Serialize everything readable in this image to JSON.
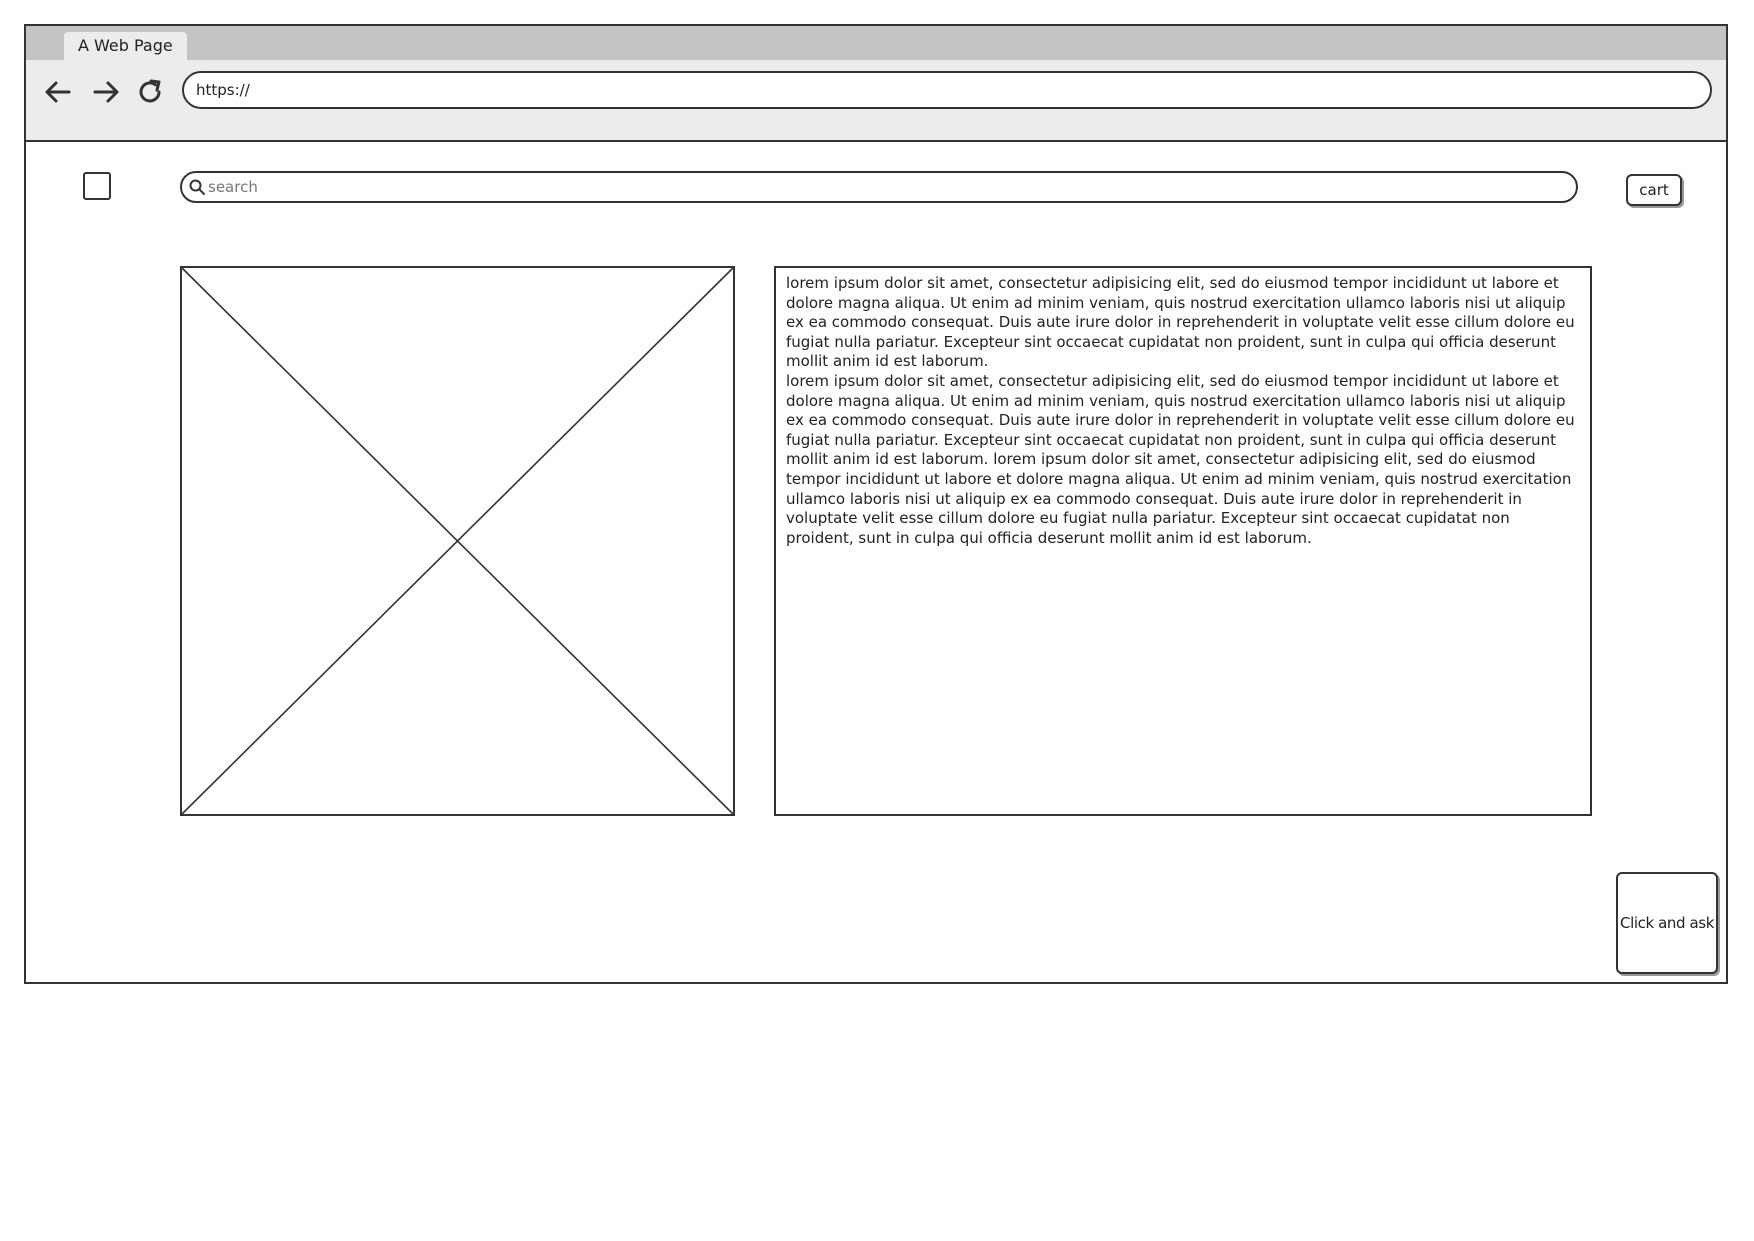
{
  "browser": {
    "tab_title": "A Web Page",
    "url": "https://"
  },
  "header": {
    "search_placeholder": "search",
    "cart_label": "cart"
  },
  "content": {
    "paragraph_1": "lorem ipsum dolor sit amet, consectetur adipisicing elit, sed do eiusmod tempor incididunt ut labore et dolore magna aliqua. Ut enim ad minim veniam, quis nostrud exercitation ullamco laboris nisi ut aliquip ex ea commodo consequat. Duis aute irure dolor in reprehenderit in voluptate velit esse cillum dolore eu fugiat nulla pariatur. Excepteur sint occaecat cupidatat non proident, sunt in culpa qui officia deserunt mollit anim id est laborum.",
    "paragraph_2": "lorem ipsum dolor sit amet, consectetur adipisicing elit, sed do eiusmod tempor incididunt ut labore et dolore magna aliqua. Ut enim ad minim veniam, quis nostrud exercitation ullamco laboris nisi ut aliquip ex ea commodo consequat. Duis aute irure dolor in reprehenderit in voluptate velit esse cillum dolore eu fugiat nulla pariatur. Excepteur sint occaecat cupidatat non proident, sunt in culpa qui officia deserunt mollit anim id est laborum. lorem ipsum dolor sit amet, consectetur adipisicing elit, sed do eiusmod tempor incididunt ut labore et dolore magna aliqua. Ut enim ad minim veniam, quis nostrud exercitation ullamco laboris nisi ut aliquip ex ea commodo consequat. Duis aute irure dolor in reprehenderit in voluptate velit esse cillum dolore eu fugiat nulla pariatur. Excepteur sint occaecat cupidatat non proident, sunt in culpa qui officia deserunt mollit anim id est laborum."
  },
  "ask_button_label": "Click and ask",
  "icons": {
    "back": "arrow-left-icon",
    "forward": "arrow-right-icon",
    "reload": "reload-icon",
    "search": "search-icon",
    "image": "image-placeholder-icon"
  },
  "colors": {
    "tab_strip": "#c4c4c4",
    "toolbar": "#ececec",
    "stroke": "#333333"
  }
}
